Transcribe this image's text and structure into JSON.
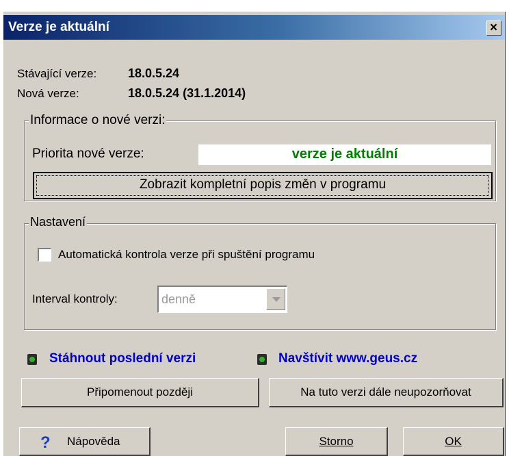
{
  "window": {
    "title": "Verze je aktuální",
    "close_glyph": "×"
  },
  "versions": {
    "current_label": "Stávající verze:",
    "current_value": "18.0.5.24",
    "new_label": "Nová verze:",
    "new_value": "18.0.5.24 (31.1.2014)"
  },
  "info_group": {
    "legend": "Informace o nové verzi:",
    "priority_label": "Priorita nové verze:",
    "priority_value": "verze je aktuální",
    "show_changes_button": "Zobrazit kompletní popis změn v programu"
  },
  "settings_group": {
    "legend": "Nastavení",
    "auto_check_label": "Automatická kontrola verze při spuštění programu",
    "auto_check_checked": false,
    "interval_label": "Interval kontroly:",
    "interval_value": "denně"
  },
  "links": {
    "download": "Stáhnout poslední verzi",
    "visit": "Navštívit www.geus.cz"
  },
  "buttons": {
    "remind_later": "Připomenout později",
    "dont_notify": "Na tuto verzi dále neupozorňovat",
    "help": "Nápověda",
    "help_icon_glyph": "?",
    "cancel": "Storno",
    "ok": "OK"
  },
  "colors": {
    "dialog_bg": "#d4d0c8",
    "title_gradient_start": "#0a246a",
    "title_gradient_end": "#a6caf0",
    "priority_text": "#008000",
    "link_text": "#0000cc",
    "led_green": "#2fb12f"
  }
}
